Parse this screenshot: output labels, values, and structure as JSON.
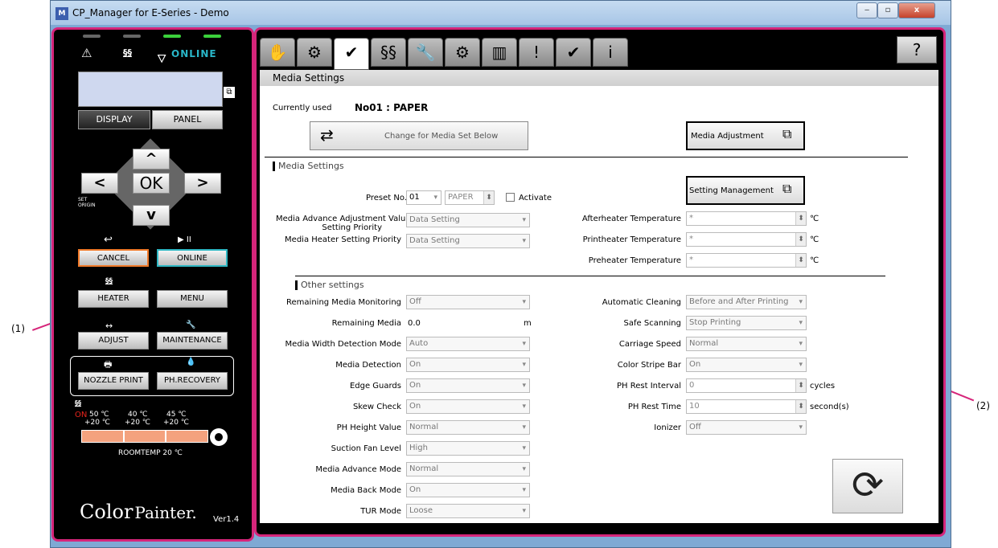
{
  "window": {
    "title": "CP_Manager for E-Series - Demo",
    "app_icon": "app-icon",
    "min": "‒",
    "max": "▫",
    "close": "x"
  },
  "callouts": {
    "left": "(1)",
    "right": "(2)"
  },
  "panel": {
    "icons": {
      "warning": "⚠",
      "heater": "§§",
      "ink": "🜄"
    },
    "online_status": "ONLINE",
    "display_label": "DISPLAY",
    "panel_label": "PANEL",
    "nav": {
      "up": "^",
      "left": "<",
      "ok": "OK",
      "right": ">",
      "down": "v"
    },
    "set_origin_1": "SET",
    "set_origin_2": "ORIGIN",
    "cancel_icon": "↩",
    "online_icon": "▶ II",
    "cancel": "CANCEL",
    "online": "ONLINE",
    "heater_icon": "§§",
    "heater": "HEATER",
    "menu": "MENU",
    "adjust_icon": "↔",
    "adjust": "ADJUST",
    "maintenance_icon": "🔧",
    "maintenance": "MAINTENANCE",
    "nozzle_icon": "🖶",
    "nozzle_print": "NOZZLE PRINT",
    "ph_icon": "💧",
    "ph_recovery": "PH.RECOVERY",
    "temp_icon": "§§",
    "temp_on": "ON",
    "temps_top": [
      "50 ℃",
      "40 ℃",
      "45 ℃"
    ],
    "temps_bottom": [
      "+20 ℃",
      "+20 ℃",
      "+20 ℃"
    ],
    "roomtemp": "ROOMTEMP  20 ℃",
    "logo_color": "Color",
    "logo_painter": "Painter.",
    "version": "Ver1.4"
  },
  "tabs": [
    "✋",
    "⚙",
    "✔",
    "§§",
    "🔧",
    "⚙",
    "▥",
    "!",
    "✔",
    "i"
  ],
  "help_icon": "?",
  "content": {
    "header": "Media Settings",
    "currently_used_label": "Currently used",
    "currently_used_value": "No01 : PAPER",
    "change_button": "Change for Media Set Below",
    "change_icon": "⇄",
    "media_adjustment": "Media Adjustment",
    "section_media": "Media Settings",
    "setting_management": "Setting Management",
    "preset_label": "Preset No.",
    "preset_value": "01",
    "preset_name": "PAPER",
    "activate": "Activate",
    "left_fields": [
      {
        "label": "Media Advance Adjustment Value",
        "value": "Data Setting"
      },
      {
        "label": "Media Heater Setting Priority",
        "value": "Data Setting"
      }
    ],
    "setting_priority": "Setting Priority",
    "heaters": [
      {
        "label": "Afterheater Temperature",
        "value": "*",
        "unit": "℃"
      },
      {
        "label": "Printheater Temperature",
        "value": "*",
        "unit": "℃"
      },
      {
        "label": "Preheater Temperature",
        "value": "*",
        "unit": "℃"
      }
    ],
    "section_other": "Other settings",
    "other_left": [
      {
        "label": "Remaining Media Monitoring",
        "value": "Off"
      },
      {
        "label": "Remaining Media",
        "value": "0.0",
        "unit": "m"
      },
      {
        "label": "Media Width Detection Mode",
        "value": "Auto"
      },
      {
        "label": "Media Detection",
        "value": "On"
      },
      {
        "label": "Edge Guards",
        "value": "On"
      },
      {
        "label": "Skew Check",
        "value": "On"
      },
      {
        "label": "PH Height Value",
        "value": "Normal"
      },
      {
        "label": "Suction Fan Level",
        "value": "High"
      },
      {
        "label": "Media Advance Mode",
        "value": "Normal"
      },
      {
        "label": "Media Back Mode",
        "value": "On"
      },
      {
        "label": "TUR Mode",
        "value": "Loose"
      }
    ],
    "other_right": [
      {
        "label": "Automatic Cleaning",
        "value": "Before and After Printing"
      },
      {
        "label": "Safe Scanning",
        "value": "Stop Printing"
      },
      {
        "label": "Carriage Speed",
        "value": "Normal"
      },
      {
        "label": "Color Stripe Bar",
        "value": "On"
      },
      {
        "label": "PH Rest Interval",
        "value": "0",
        "unit": "cycles"
      },
      {
        "label": "PH Rest Time",
        "value": "10",
        "unit": "second(s)"
      },
      {
        "label": "Ionizer",
        "value": "Off"
      }
    ],
    "refresh_icon": "⟳"
  }
}
